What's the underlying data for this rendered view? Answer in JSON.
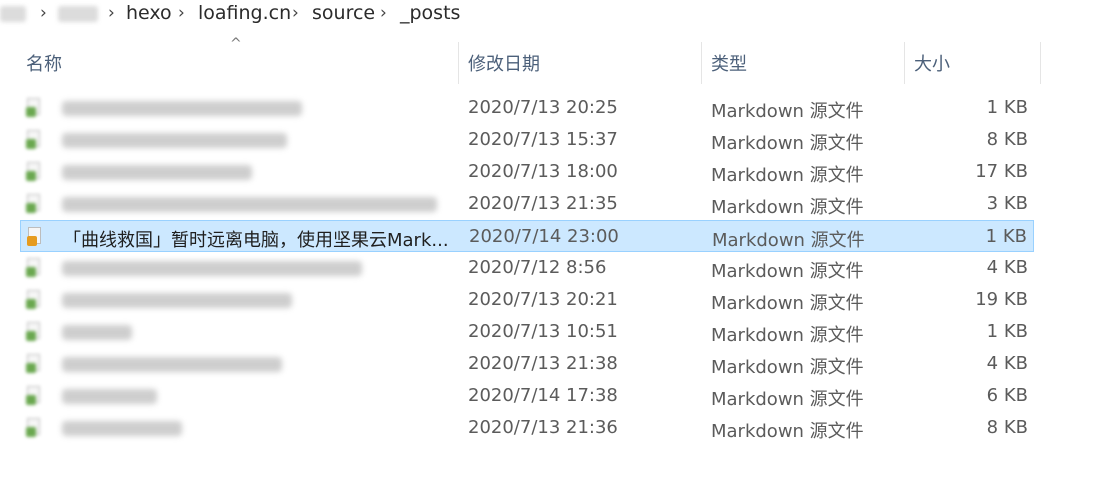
{
  "breadcrumb": {
    "items": [
      "hexo",
      "loafing.cn",
      "source",
      "_posts"
    ],
    "separator": "›"
  },
  "columns": {
    "name": "名称",
    "modified": "修改日期",
    "type": "类型",
    "size": "大小",
    "sort_indicator": "^"
  },
  "files": [
    {
      "name": "",
      "blurred": true,
      "modified": "2020/7/13 20:25",
      "type": "Markdown 源文件",
      "size": "1 KB",
      "selected": false
    },
    {
      "name": "",
      "blurred": true,
      "modified": "2020/7/13 15:37",
      "type": "Markdown 源文件",
      "size": "8 KB",
      "selected": false
    },
    {
      "name": "",
      "blurred": true,
      "modified": "2020/7/13 18:00",
      "type": "Markdown 源文件",
      "size": "17 KB",
      "selected": false
    },
    {
      "name": "",
      "blurred": true,
      "modified": "2020/7/13 21:35",
      "type": "Markdown 源文件",
      "size": "3 KB",
      "selected": false
    },
    {
      "name": "「曲线救国」暂时远离电脑，使用坚果云Mark...",
      "blurred": false,
      "modified": "2020/7/14 23:00",
      "type": "Markdown 源文件",
      "size": "1 KB",
      "selected": true
    },
    {
      "name": "",
      "blurred": true,
      "modified": "2020/7/12 8:56",
      "type": "Markdown 源文件",
      "size": "4 KB",
      "selected": false
    },
    {
      "name": "",
      "blurred": true,
      "modified": "2020/7/13 20:21",
      "type": "Markdown 源文件",
      "size": "19 KB",
      "selected": false
    },
    {
      "name": "",
      "blurred": true,
      "modified": "2020/7/13 10:51",
      "type": "Markdown 源文件",
      "size": "1 KB",
      "selected": false
    },
    {
      "name": "",
      "blurred": true,
      "modified": "2020/7/13 21:38",
      "type": "Markdown 源文件",
      "size": "4 KB",
      "selected": false
    },
    {
      "name": "",
      "blurred": true,
      "modified": "2020/7/14 17:38",
      "type": "Markdown 源文件",
      "size": "6 KB",
      "selected": false
    },
    {
      "name": "",
      "blurred": true,
      "modified": "2020/7/13 21:36",
      "type": "Markdown 源文件",
      "size": "8 KB",
      "selected": false
    }
  ],
  "colors": {
    "selection_bg": "#cce8ff",
    "selection_border": "#99d1ff",
    "header_text": "#4c607a"
  }
}
